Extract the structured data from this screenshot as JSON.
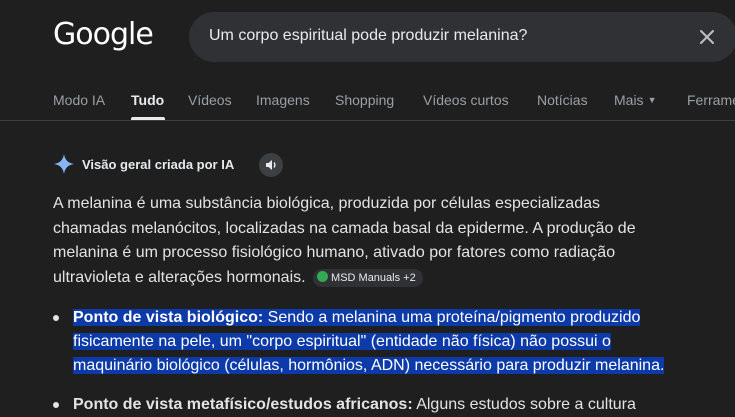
{
  "header": {
    "logo_text": "Google",
    "search_value": "Um corpo espiritual pode produzir melanina?"
  },
  "tabs": [
    {
      "label": "Modo IA"
    },
    {
      "label": "Tudo"
    },
    {
      "label": "Vídeos"
    },
    {
      "label": "Imagens"
    },
    {
      "label": "Shopping"
    },
    {
      "label": "Vídeos curtos"
    },
    {
      "label": "Notícias"
    },
    {
      "label": "Mais"
    },
    {
      "label": "Ferrame"
    }
  ],
  "active_tab": "Tudo",
  "ai_overview": {
    "title": "Visão geral criada por IA",
    "paragraph": "A melanina é uma substância biológica, produzida por células especializadas chamadas melanócitos, localizadas na camada basal da epiderme. A produção de melanina é um processo fisiológico humano, ativado por fatores como radiação ultravioleta e alterações hormonais.",
    "source_chip": "MSD Manuals +2",
    "bullets": [
      {
        "bold": "Ponto de vista biológico:",
        "text": " Sendo a melanina uma proteína/pigmento produzido fisicamente na pele, um \"corpo espiritual\" (entidade não física) não possui o maquinário biológico (células, hormônios, ADN) necessário para produzir melanina."
      },
      {
        "bold": "Ponto de vista metafísico/estudos africanos:",
        "text": " Alguns estudos sobre a cultura"
      }
    ]
  },
  "colors": {
    "background": "#1f1f1f",
    "search_bg": "#303134",
    "highlight": "#0c3aa8",
    "sparkle": "#8ab4f8"
  }
}
